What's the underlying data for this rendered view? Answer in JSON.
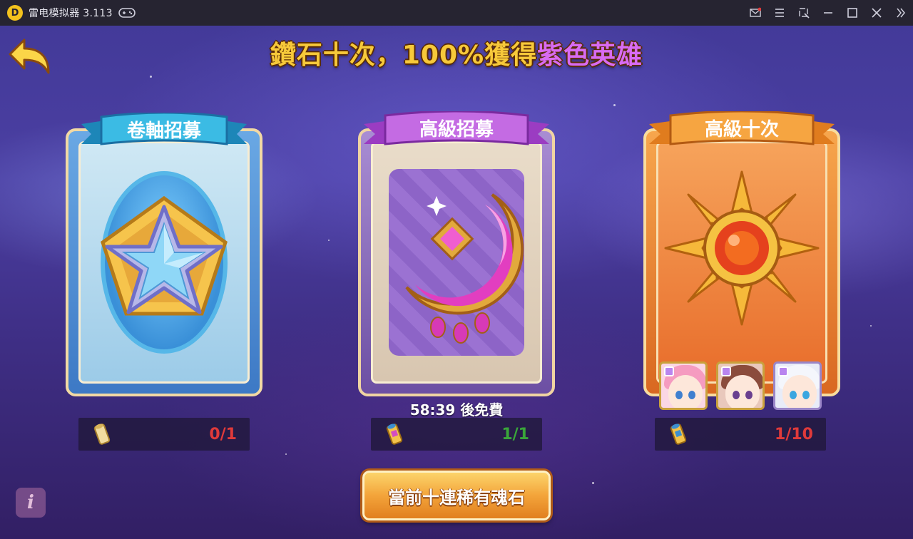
{
  "emulator": {
    "title": "雷电模拟器 3.113",
    "logo_glyph": "D"
  },
  "game": {
    "headline_main": "鑽石十次，100%獲得",
    "headline_accent": "紫色英雄",
    "headline_accent_color": "#d86bf3",
    "cards": [
      {
        "banner": "卷軸招募",
        "theme": "blue",
        "count": "0/1",
        "count_color": "#e03a3a"
      },
      {
        "banner": "高級招募",
        "theme": "purple",
        "count": "1/1",
        "count_color": "#3aa63a"
      },
      {
        "banner": "高級十次",
        "theme": "orange",
        "count": "1/10",
        "count_color": "#e03a3a"
      }
    ],
    "countdown": "58:39 後免費",
    "bottom_button": "當前十連稀有魂石",
    "info_glyph": "i"
  }
}
